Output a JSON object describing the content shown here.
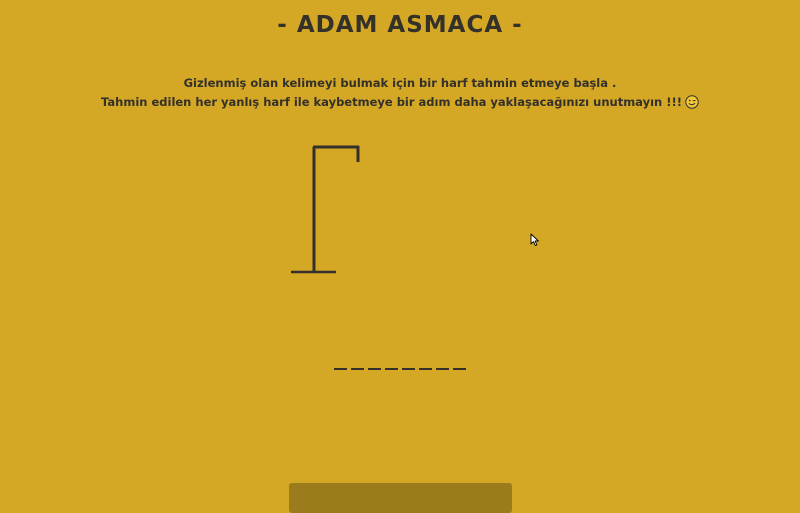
{
  "game": {
    "title": "- ADAM ASMACA -",
    "instructions": {
      "line1": "Gizlenmiş olan kelimeyi bulmak için bir harf tahmin etmeye başla .",
      "line2": "Tahmin edilen her yanlış harf ile kaybetmeye bir adım daha yaklaşacağınızı unutmayın !!!",
      "emoji_icon": "wink-emoji-icon"
    },
    "word": {
      "letters": [
        "",
        "",
        "",
        "",
        "",
        "",
        "",
        ""
      ]
    },
    "wrong_guess_count": 0
  },
  "colors": {
    "background": "#d4a725",
    "text": "#34302a",
    "panel": "#9b7b1b"
  }
}
